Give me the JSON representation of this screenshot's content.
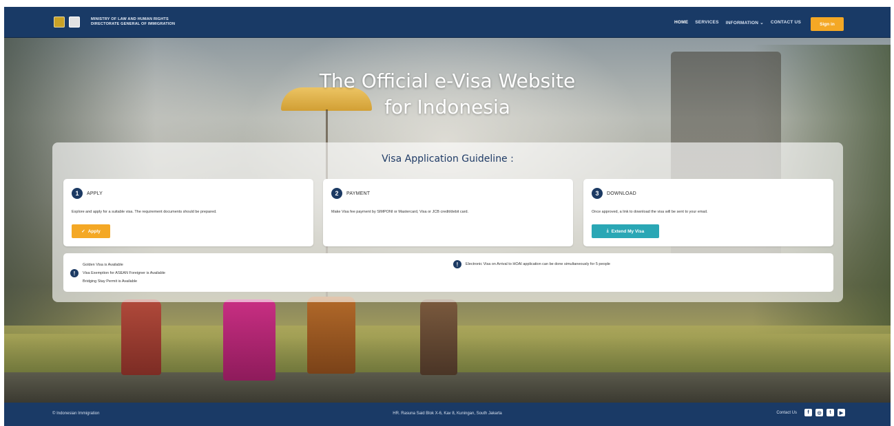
{
  "header": {
    "ministry_line1": "MINISTRY OF LAW AND HUMAN RIGHTS",
    "ministry_line2": "DIRECTORATE GENERAL OF IMMIGRATION",
    "nav": [
      "HOME",
      "SERVICES",
      "INFORMATION ⌄",
      "CONTACT US"
    ],
    "signin_label": "Sign in"
  },
  "hero": {
    "title_line1": "The Official e-Visa Website",
    "title_line2": "for Indonesia"
  },
  "guideline": {
    "title": "Visa Application Guideline :",
    "steps": [
      {
        "number": "1",
        "label": "APPLY",
        "description": "Explore and apply for a suitable visa. The requirement documents should be prepared.",
        "button": "Apply"
      },
      {
        "number": "2",
        "label": "PAYMENT",
        "description": "Make Visa fee payment by SIMPONI or Mastercard, Visa or JCB credit/debit card."
      },
      {
        "number": "3",
        "label": "DOWNLOAD",
        "description": "Once approved, a link to download the visa will be sent to your email.",
        "button": "Extend My Visa"
      }
    ],
    "notices_left": [
      "Golden Visa is Available",
      "Visa Exemption for ASEAN Foreigner is Available",
      "Bridging Stay Permit is Available"
    ],
    "notice_right": "Electronic Visa on Arrival to HOAI application can be done simultaneously for 5 people"
  },
  "footer": {
    "copyright": "© Indonesian Immigration",
    "address": "HR. Rasuna Said Blok X-6, Kav 8, Kuningan, South Jakarta",
    "contact_label": "Contact Us"
  },
  "colors": {
    "navy": "#1c3a63",
    "accent_orange": "#f4a825",
    "accent_teal": "#2aa7b5"
  }
}
